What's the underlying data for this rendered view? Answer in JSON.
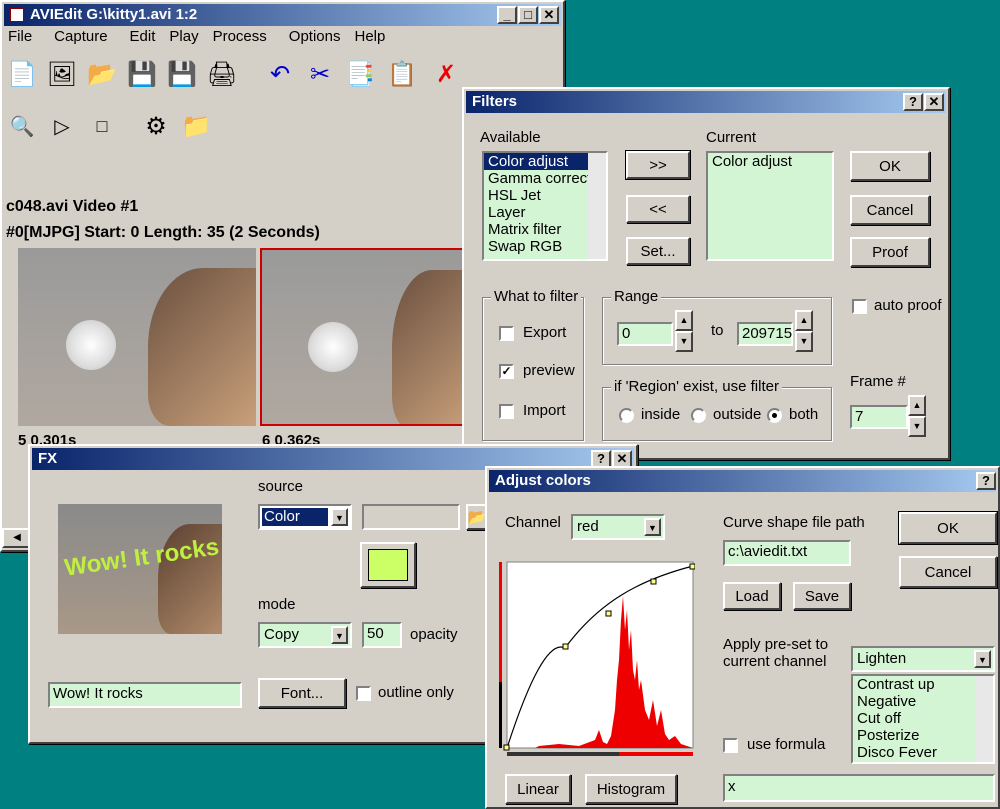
{
  "main": {
    "title": "AVIEdit G:\\kitty1.avi  1:2",
    "menu": [
      "File",
      "Capture",
      "Edit",
      "Play",
      "Process",
      "Options",
      "Help"
    ],
    "clip_title": "c048.avi Video #1",
    "clip_info": "#0[MJPG] Start: 0 Length: 35 (2 Seconds)",
    "frame1_label": "5 0.301s",
    "frame2_label": "6 0.362s"
  },
  "filters": {
    "title": "Filters",
    "available_label": "Available",
    "available": [
      "Color adjust",
      "Gamma correcti",
      "HSL Jet",
      "Layer",
      "Matrix filter",
      "Swap RGB"
    ],
    "add_btn": ">>",
    "remove_btn": "<<",
    "set_btn": "Set...",
    "current_label": "Current",
    "current": [
      "Color adjust"
    ],
    "ok": "OK",
    "cancel": "Cancel",
    "proof": "Proof",
    "auto_proof": "auto proof",
    "what_to_filter": "What to filter",
    "export": "Export",
    "preview": "preview",
    "import": "Import",
    "range": "Range",
    "range_from": "0",
    "to": "to",
    "range_to": "209715",
    "region": "if 'Region' exist, use filter",
    "inside": "inside",
    "outside": "outside",
    "both": "both",
    "frame_label": "Frame #",
    "frame_value": "7"
  },
  "fx": {
    "title": "FX",
    "preview_text": "Wow! It rocks",
    "source_label": "source",
    "source_value": "Color",
    "color_swatch": "#ccff66",
    "mode_label": "mode",
    "mode_value": "Copy",
    "opacity_value": "50",
    "opacity_label": "opacity",
    "text_value": "Wow! It rocks",
    "font_btn": "Font...",
    "outline_only": "outline only"
  },
  "adjust": {
    "title": "Adjust colors",
    "channel_label": "Channel",
    "channel_value": "red",
    "curve_path_label": "Curve shape file path",
    "curve_path_value": "c:\\aviedit.txt",
    "load": "Load",
    "save": "Save",
    "ok": "OK",
    "cancel": "Cancel",
    "preset_label": "Apply pre-set to current channel",
    "preset_value": "Lighten",
    "presets": [
      "Contrast up",
      "Negative",
      "Cut off",
      "Posterize",
      "Disco Fever"
    ],
    "use_formula": "use formula",
    "formula_value": "x",
    "linear": "Linear",
    "histogram": "Histogram"
  }
}
